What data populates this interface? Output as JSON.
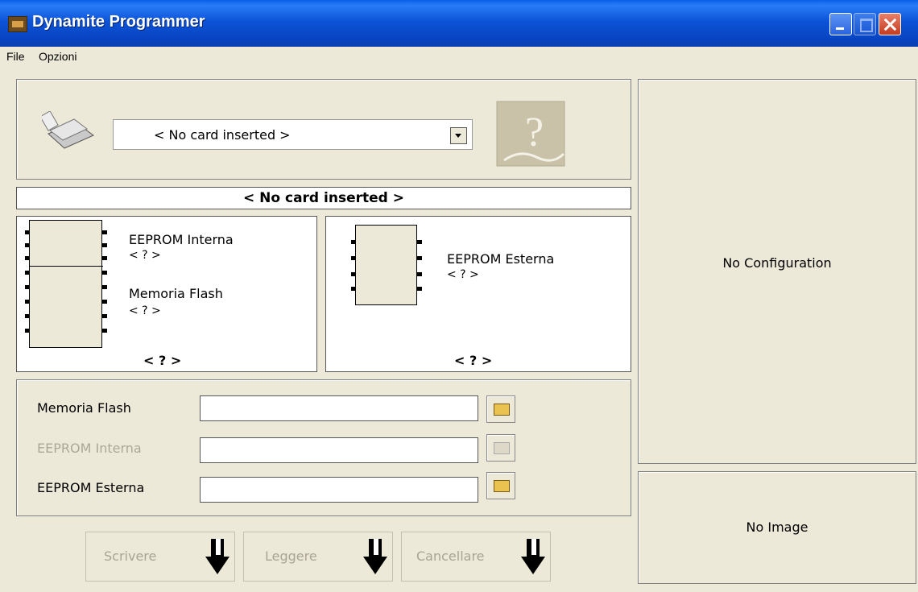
{
  "window": {
    "title": "Dynamite Programmer"
  },
  "menu": {
    "items": [
      "File",
      "Opzioni"
    ]
  },
  "card": {
    "dropdown_value": "< No card inserted >",
    "banner": "< No card inserted >"
  },
  "memory": {
    "left": {
      "eeprom_internal_label": "EEPROM Interna",
      "eeprom_internal_value": "< ? >",
      "flash_label": "Memoria Flash",
      "flash_value": "< ? >",
      "footer": "< ? >"
    },
    "right": {
      "eeprom_external_label": "EEPROM Esterna",
      "eeprom_external_value": "< ? >",
      "footer": "< ? >"
    }
  },
  "files": {
    "flash": {
      "label": "Memoria Flash",
      "value": ""
    },
    "eeprom_internal": {
      "label": "EEPROM Interna",
      "value": "",
      "disabled": true
    },
    "eeprom_external": {
      "label": "EEPROM Esterna",
      "value": ""
    }
  },
  "actions": {
    "write": "Scrivere",
    "read": "Leggere",
    "erase": "Cancellare"
  },
  "side": {
    "configuration": "No Configuration",
    "image": "No Image"
  }
}
